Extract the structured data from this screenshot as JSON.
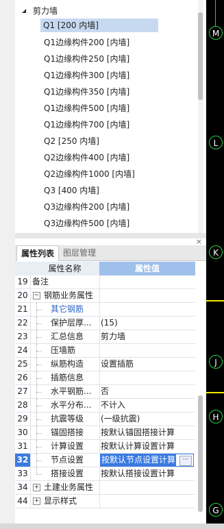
{
  "tree": {
    "group_label": "剪力墙",
    "items": [
      "Q1 [200 内墙]",
      "Q1边缘构件200 [内墙]",
      "Q1边缘构件250 [内墙]",
      "Q1边缘构件300 [内墙]",
      "Q1边缘构件350 [内墙]",
      "Q1边缘构件500 [内墙]",
      "Q1边缘构件700 [内墙]",
      "Q2 [250 内墙]",
      "Q2边缘构件400 [内墙]",
      "Q2边缘构件1000 [内墙]",
      "Q3 [400 内墙]",
      "Q3边缘构件200 [内墙]",
      "Q3边缘构件500 [内墙]"
    ],
    "selected_index": 0
  },
  "props": {
    "close_label": "×",
    "tabs": [
      "属性列表",
      "图层管理"
    ],
    "header": {
      "name": "属性名称",
      "value": "属性值"
    },
    "rows": [
      {
        "num": "19",
        "name": "备注",
        "value": ""
      },
      {
        "num": "20",
        "name": "钢筋业务属性",
        "value": "",
        "expander": "−"
      },
      {
        "num": "21",
        "name": "其它钢筋",
        "value": ""
      },
      {
        "num": "22",
        "name": "保护层厚...",
        "value": "(15)"
      },
      {
        "num": "23",
        "name": "汇总信息",
        "value": "剪力墙"
      },
      {
        "num": "24",
        "name": "压墙筋",
        "value": ""
      },
      {
        "num": "25",
        "name": "纵筋构造",
        "value": "设置插筋"
      },
      {
        "num": "26",
        "name": "插筋信息",
        "value": ""
      },
      {
        "num": "27",
        "name": "水平钢筋...",
        "value": "否"
      },
      {
        "num": "28",
        "name": "水平分布...",
        "value": "不计入"
      },
      {
        "num": "29",
        "name": "抗震等级",
        "value": "(一级抗震)"
      },
      {
        "num": "30",
        "name": "锚固搭接",
        "value": "按默认锚固搭接计算"
      },
      {
        "num": "31",
        "name": "计算设置",
        "value": "按默认计算设置计算"
      },
      {
        "num": "32",
        "name": "节点设置",
        "value": "按默认节点设置计算"
      },
      {
        "num": "33",
        "name": "搭接设置",
        "value": "按默认搭接设置计算"
      },
      {
        "num": "34",
        "name": "土建业务属性",
        "value": "",
        "expander": "+"
      },
      {
        "num": "44",
        "name": "显示样式",
        "value": "",
        "expander": "+"
      }
    ],
    "edit_button": "···"
  },
  "axis_labels": [
    "M",
    "L",
    "K",
    "J",
    "H",
    "G"
  ],
  "colors": {
    "accent": "#3a7be0",
    "selection": "#c7d9f1",
    "axis_green": "#2ed04a",
    "yellow": "#f2e600"
  }
}
